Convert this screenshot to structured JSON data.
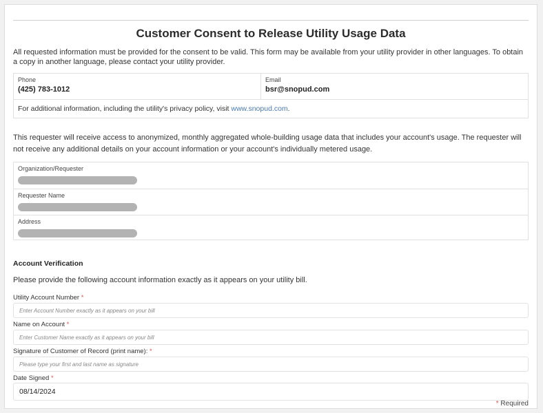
{
  "form": {
    "title": "Customer Consent to Release Utility Usage Data",
    "intro": "All requested information must be provided for the consent to be valid. This form may be available from your utility provider in other languages. To obtain a copy in another language, please contact your utility provider."
  },
  "contact": {
    "phone_label": "Phone",
    "phone_value": "(425) 783-1012",
    "email_label": "Email",
    "email_value": "bsr@snopud.com",
    "info_prefix": "For additional information, including the utility's privacy policy, visit ",
    "info_link": "www.snopud.com",
    "info_suffix": "."
  },
  "notice": "This requester will receive access to anonymized, monthly aggregated whole-building usage data that includes your account's usage. The requester will not receive any additional details on your account information or your account's individually metered usage.",
  "requester": {
    "org_label": "Organization/Requester",
    "name_label": "Requester Name",
    "address_label": "Address"
  },
  "verification": {
    "heading": "Account Verification",
    "description": "Please provide the following account information exactly as it appears on your utility bill.",
    "required_star": "*",
    "account_number_label": "Utility Account Number",
    "account_number_placeholder": "Enter Account Number exactly as it appears on your bill",
    "name_label": "Name on Account",
    "name_placeholder": "Enter Customer Name exactly as it appears on your bill",
    "signature_label": "Signature of Customer of Record (print name):",
    "signature_placeholder": "Please type your first and last name as signature",
    "date_label": "Date Signed",
    "date_value": "08/14/2024",
    "required_note": "Required"
  }
}
